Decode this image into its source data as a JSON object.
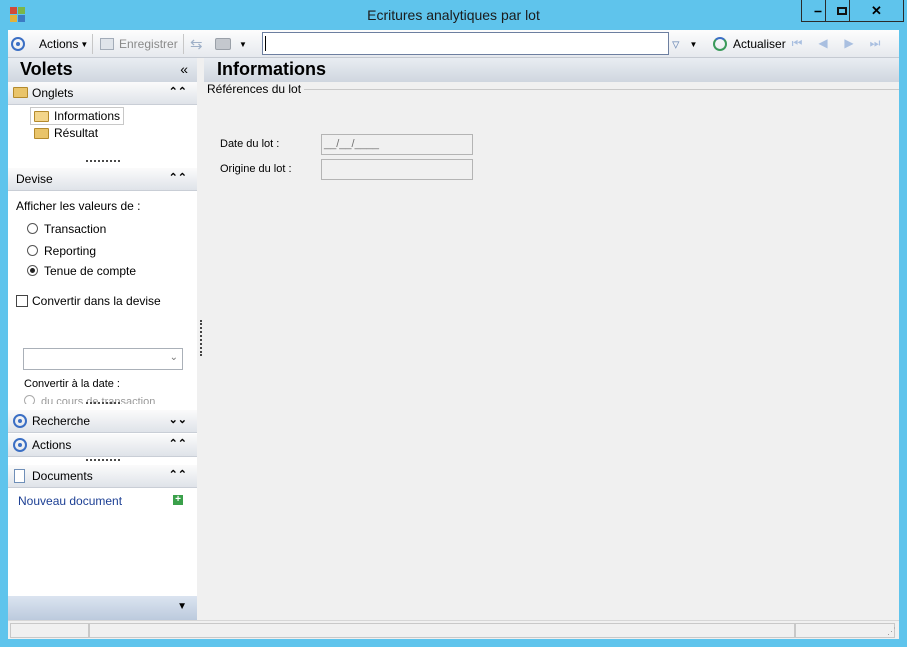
{
  "window": {
    "title": "Ecritures analytiques par lot"
  },
  "toolbar": {
    "actions_label": "Actions",
    "save_label": "Enregistrer",
    "refresh_label": "Actualiser",
    "search_value": ""
  },
  "left": {
    "volets_title": "Volets",
    "onglets": {
      "title": "Onglets",
      "items": [
        "Informations",
        "Résultat"
      ]
    },
    "devise": {
      "title": "Devise",
      "show_values_label": "Afficher les valeurs de :",
      "options": [
        "Transaction",
        "Reporting",
        "Tenue de compte"
      ],
      "selected": "Tenue de compte",
      "convert_label": "Convertir dans la devise",
      "convert_date_label": "Convertir à la date :",
      "partial_option": "du cours de transaction"
    },
    "recherche": {
      "title": "Recherche"
    },
    "actions": {
      "title": "Actions"
    },
    "documents": {
      "title": "Documents",
      "new_doc": "Nouveau document"
    }
  },
  "main": {
    "title": "Informations",
    "group_title": "Références du lot",
    "date_label": "Date du lot :",
    "date_value": "__/__/____",
    "origin_label": "Origine du lot :",
    "origin_value": ""
  },
  "colors": {
    "title_bar": "#5fc4ec",
    "accent_blue": "#3b6fc4"
  }
}
